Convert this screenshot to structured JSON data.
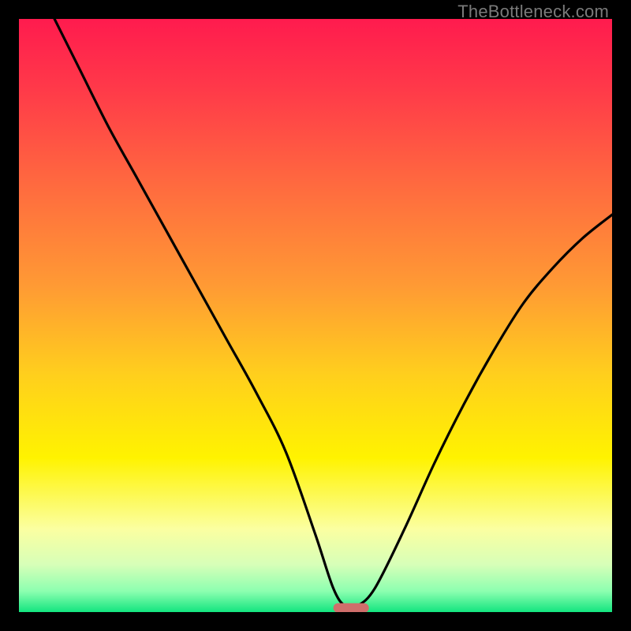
{
  "watermark": "TheBottleneck.com",
  "colors": {
    "gradient_stops": [
      {
        "offset": 0.0,
        "color": "#ff1b4e"
      },
      {
        "offset": 0.12,
        "color": "#ff3a49"
      },
      {
        "offset": 0.28,
        "color": "#ff6a3f"
      },
      {
        "offset": 0.45,
        "color": "#ff9a34"
      },
      {
        "offset": 0.6,
        "color": "#ffcf1d"
      },
      {
        "offset": 0.74,
        "color": "#fff300"
      },
      {
        "offset": 0.86,
        "color": "#fbffa1"
      },
      {
        "offset": 0.92,
        "color": "#d7ffb8"
      },
      {
        "offset": 0.965,
        "color": "#8cffb0"
      },
      {
        "offset": 1.0,
        "color": "#13e57f"
      }
    ],
    "curve": "#000000",
    "marker": "#cf6e6b",
    "background": "#000000"
  },
  "chart_data": {
    "type": "line",
    "title": "",
    "xlabel": "",
    "ylabel": "",
    "xlim": [
      0,
      100
    ],
    "ylim": [
      0,
      100
    ],
    "series": [
      {
        "name": "bottleneck-curve",
        "x": [
          6,
          10,
          15,
          20,
          25,
          30,
          35,
          40,
          45,
          50,
          53,
          55,
          57,
          60,
          65,
          70,
          75,
          80,
          85,
          90,
          95,
          100
        ],
        "y": [
          100,
          92,
          82,
          73,
          64,
          55,
          46,
          37,
          27,
          13,
          4,
          1,
          1,
          4,
          14,
          25,
          35,
          44,
          52,
          58,
          63,
          67
        ]
      }
    ],
    "annotations": [
      {
        "type": "marker",
        "shape": "rounded-rect",
        "x_center": 56,
        "y": 0.7,
        "width": 6,
        "height": 1.6
      }
    ]
  }
}
